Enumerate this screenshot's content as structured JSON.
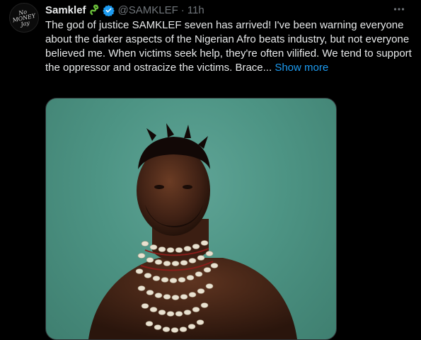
{
  "tweet": {
    "avatar_text": "No MONEY Jay",
    "display_name": "Samklef",
    "handle": "@SAMKLEF",
    "separator": "·",
    "time": "11h",
    "more_icon": "more-horizontal-icon",
    "text": "The god of justice SAMKLEF seven has arrived! I've been warning everyone about the darker aspects of the Nigerian Afro beats industry, but not everyone believed me. When victims seek help, they're often vilified. We tend to support the oppressor and ostracize the victims. Brace... ",
    "show_more": "Show more",
    "accent_color": "#1d9bf0",
    "verified_color": "#1d9bf0"
  }
}
